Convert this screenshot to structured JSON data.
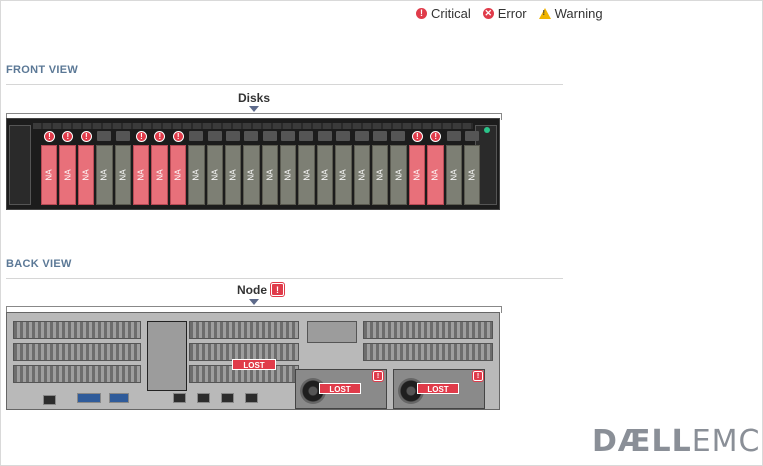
{
  "legend": {
    "critical_label": "Critical",
    "error_label": "Error",
    "warning_label": "Warning",
    "colors": {
      "critical": "#e03b4a",
      "error": "#e03b4a",
      "warning": "#f0b400"
    }
  },
  "front_view": {
    "title": "FRONT VIEW",
    "group_label": "Disks",
    "disks": [
      {
        "label": "NA",
        "status": "critical"
      },
      {
        "label": "NA",
        "status": "critical"
      },
      {
        "label": "NA",
        "status": "critical"
      },
      {
        "label": "NA",
        "status": "ok"
      },
      {
        "label": "NA",
        "status": "ok"
      },
      {
        "label": "NA",
        "status": "critical"
      },
      {
        "label": "NA",
        "status": "critical"
      },
      {
        "label": "NA",
        "status": "critical"
      },
      {
        "label": "NA",
        "status": "ok"
      },
      {
        "label": "NA",
        "status": "ok"
      },
      {
        "label": "NA",
        "status": "ok"
      },
      {
        "label": "NA",
        "status": "ok"
      },
      {
        "label": "NA",
        "status": "ok"
      },
      {
        "label": "NA",
        "status": "ok"
      },
      {
        "label": "NA",
        "status": "ok"
      },
      {
        "label": "NA",
        "status": "ok"
      },
      {
        "label": "NA",
        "status": "ok"
      },
      {
        "label": "NA",
        "status": "ok"
      },
      {
        "label": "NA",
        "status": "ok"
      },
      {
        "label": "NA",
        "status": "ok"
      },
      {
        "label": "NA",
        "status": "critical"
      },
      {
        "label": "NA",
        "status": "critical"
      },
      {
        "label": "NA",
        "status": "ok"
      },
      {
        "label": "NA",
        "status": "ok"
      }
    ]
  },
  "back_view": {
    "title": "BACK VIEW",
    "group_label": "Node",
    "node_status": "critical",
    "lost_label": "LOST"
  },
  "branding": {
    "logo_bold": "DÆLL",
    "logo_light": "EMC"
  }
}
